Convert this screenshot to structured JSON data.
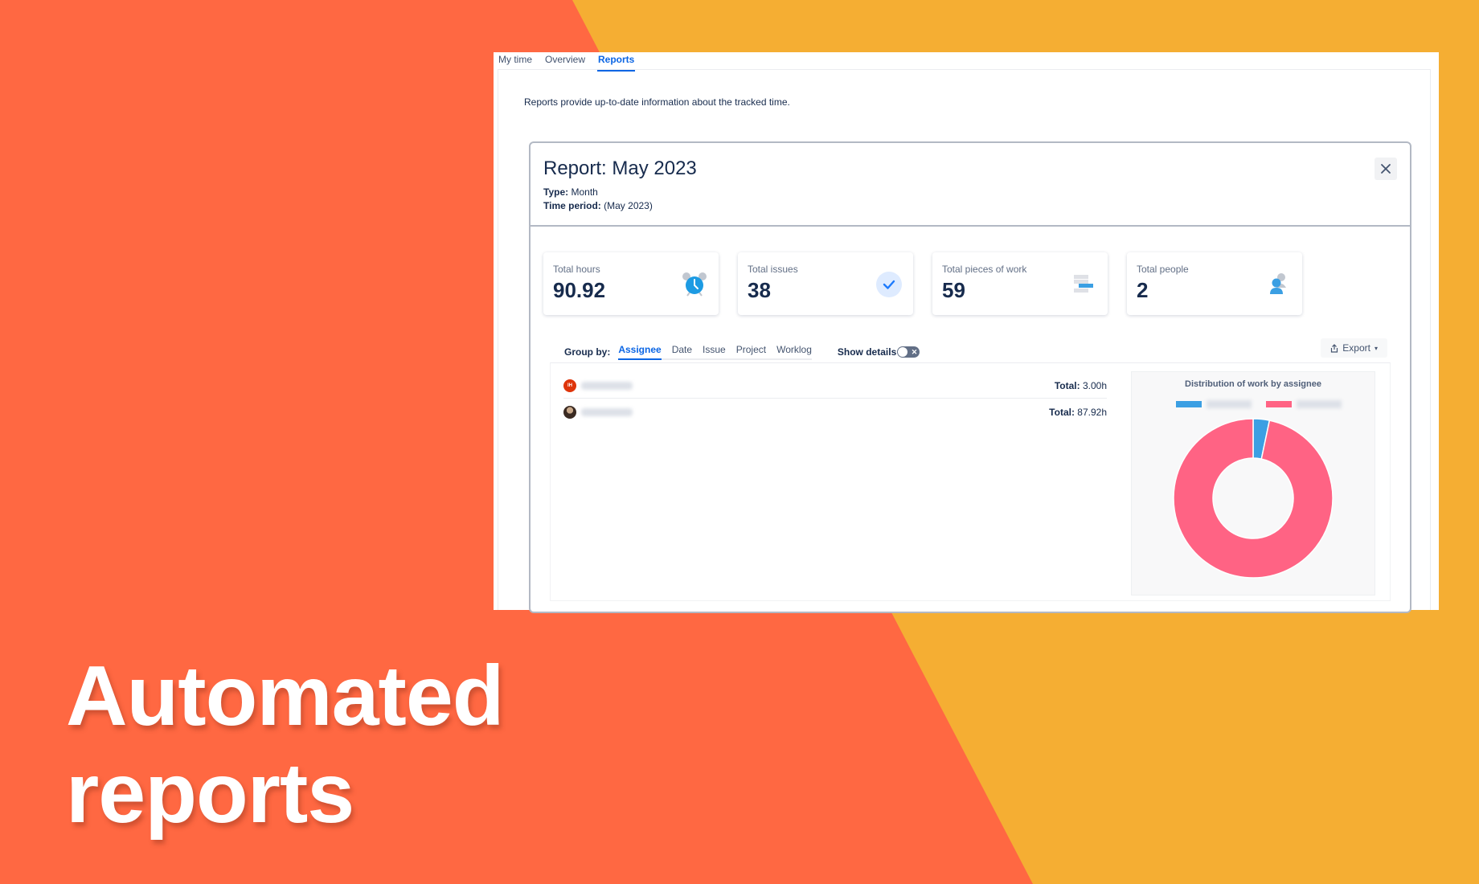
{
  "headline": {
    "line1": "Automated",
    "line2": "reports"
  },
  "colors": {
    "bg_left": "#FF6842",
    "bg_right": "#F5AE33",
    "accent": "#0C66E4",
    "series_blue": "#3B9FE3",
    "series_pink": "#FF6384"
  },
  "tabs": [
    {
      "label": "My time",
      "active": false
    },
    {
      "label": "Overview",
      "active": false
    },
    {
      "label": "Reports",
      "active": true
    }
  ],
  "intro": "Reports provide up-to-date information about the tracked time.",
  "report": {
    "title": "Report: May 2023",
    "type_label": "Type:",
    "type_value": "Month",
    "period_label": "Time period:",
    "period_value": "(May 2023)",
    "close_icon": "close-icon"
  },
  "stats": [
    {
      "label": "Total hours",
      "value": "90.92",
      "icon": "alarm-clock-icon"
    },
    {
      "label": "Total issues",
      "value": "38",
      "icon": "checkmark-icon"
    },
    {
      "label": "Total pieces of work",
      "value": "59",
      "icon": "worklog-bars-icon"
    },
    {
      "label": "Total people",
      "value": "2",
      "icon": "people-icon"
    }
  ],
  "group_by": {
    "label": "Group by:",
    "options": [
      "Assignee",
      "Date",
      "Issue",
      "Project",
      "Worklog"
    ],
    "active": "Assignee",
    "show_details_label": "Show details",
    "show_details_on": false
  },
  "export_label": "Export",
  "assignees": [
    {
      "initials": "IH",
      "total_label": "Total:",
      "total": "3.00h"
    },
    {
      "initials": "",
      "total_label": "Total:",
      "total": "87.92h"
    }
  ],
  "chart_data": {
    "type": "pie",
    "variant": "donut",
    "title": "Distribution of work by assignee",
    "legend_position": "top",
    "series": [
      {
        "name": "Assignee 1 (blurred)",
        "value": 3.0,
        "color": "#3B9FE3"
      },
      {
        "name": "Assignee 2 (blurred)",
        "value": 87.92,
        "color": "#FF6384"
      }
    ],
    "units": "hours"
  }
}
